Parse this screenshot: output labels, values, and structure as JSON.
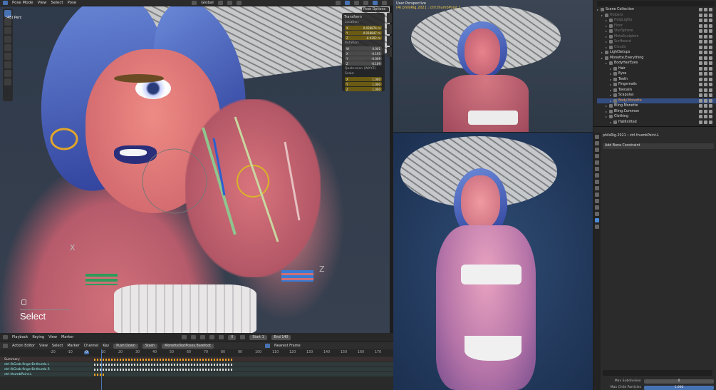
{
  "topbar": {
    "mode": "Pose Mode",
    "menu": [
      "View",
      "Select",
      "Pose"
    ],
    "orientation": "Global"
  },
  "viewport_main": {
    "overlay_label": "Select",
    "mode_label": "(48) Perc",
    "pose_options": "Pose Options",
    "transform": {
      "title": "Transform",
      "location_label": "Location:",
      "location": [
        "0.028874 m",
        "0.018847 m",
        "-0.0202 m"
      ],
      "rotation_label": "Rotation:",
      "rotation": [
        "0.001",
        "-0.195",
        "-0.009",
        "-0.109"
      ],
      "mode_label": "Quaternion (WXYZ)",
      "scale_label": "Scale:",
      "scale": [
        "1.000",
        "1.000",
        "1.000"
      ]
    }
  },
  "viewport_rt": {
    "title": "User Perspective",
    "subtitle": "(4) philsRig.2021 : ctrl.thumbPoint.L"
  },
  "outliner": {
    "rows": [
      {
        "label": "Scene Collection",
        "indent": 0,
        "dim": false
      },
      {
        "label": "Helpers",
        "indent": 1,
        "dim": true
      },
      {
        "label": "HelpLights",
        "indent": 2,
        "dim": true
      },
      {
        "label": "Floor",
        "indent": 2,
        "dim": true
      },
      {
        "label": "StarSphere",
        "indent": 2,
        "dim": true
      },
      {
        "label": "MetaSculptors",
        "indent": 2,
        "dim": true
      },
      {
        "label": "Surfboard",
        "indent": 2,
        "dim": true
      },
      {
        "label": "Clouds",
        "indent": 2,
        "dim": true
      },
      {
        "label": "LightSetups",
        "indent": 1,
        "dim": false
      },
      {
        "label": "Monette.Everything",
        "indent": 1,
        "dim": false
      },
      {
        "label": "BodyHairEyes",
        "indent": 2,
        "dim": false
      },
      {
        "label": "Hair",
        "indent": 3,
        "dim": false
      },
      {
        "label": "Eyes",
        "indent": 3,
        "dim": false
      },
      {
        "label": "Teeth",
        "indent": 3,
        "dim": false
      },
      {
        "label": "Fingernails",
        "indent": 3,
        "dim": false
      },
      {
        "label": "Toenails",
        "indent": 3,
        "dim": false
      },
      {
        "label": "Scapulas",
        "indent": 3,
        "dim": false
      },
      {
        "label": "Body.Monette",
        "indent": 3,
        "dim": false,
        "highlight": true
      },
      {
        "label": "Bling.Monette",
        "indent": 2,
        "dim": false
      },
      {
        "label": "Bling.Common",
        "indent": 2,
        "dim": false
      },
      {
        "label": "Clothing",
        "indent": 2,
        "dim": false
      },
      {
        "label": "HatKnitted",
        "indent": 3,
        "dim": false
      }
    ]
  },
  "properties": {
    "breadcrumb_rig": "philsRig.2021",
    "breadcrumb_bone": "ctrl.thumbPoint.L",
    "add_constraint": "Add Bone Constraint",
    "rows": [
      {
        "label": "Max Subdivision",
        "value": "0"
      },
      {
        "label": "Max Child Particles",
        "value": "1.000"
      }
    ]
  },
  "timeline": {
    "menu": [
      "Playback",
      "Keying",
      "View",
      "Marker"
    ],
    "current_frame": "0",
    "start_label": "Start",
    "start": "1",
    "end_label": "End",
    "end": "140"
  },
  "action_editor": {
    "editor": "Action Editor",
    "menu": [
      "View",
      "Select",
      "Marker",
      "Channel",
      "Key"
    ],
    "push_down": "Push Down",
    "stash": "Stash",
    "action_name": "MonetteTestPoses.Barefoot",
    "snap": "Nearest Frame",
    "ruler": [
      "-20",
      "-10",
      "0",
      "10",
      "20",
      "30",
      "40",
      "50",
      "60",
      "70",
      "80",
      "90",
      "100",
      "110",
      "120",
      "130",
      "140",
      "150",
      "160",
      "170"
    ],
    "ruler_current": "0",
    "channels": [
      "Summary",
      "ctrl.fkGrab.fingerBr.thumb.L",
      "ctrl.fkGrab.fingerBr.thumb.R",
      "ctrl.thumbPoint.L"
    ]
  }
}
